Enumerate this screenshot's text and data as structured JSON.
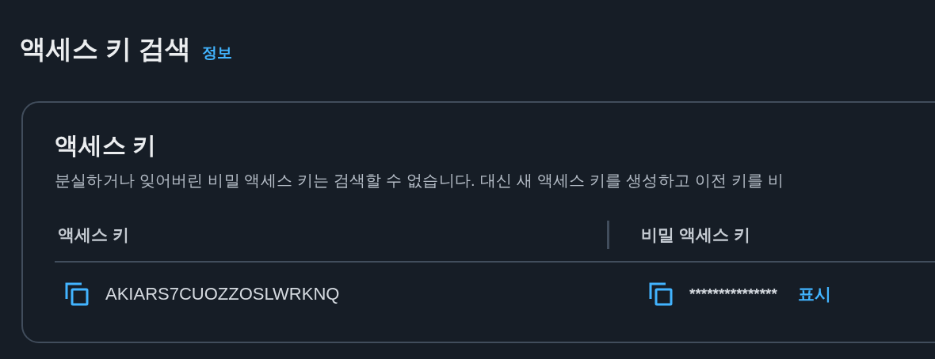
{
  "page": {
    "title": "액세스 키 검색",
    "info_link": "정보"
  },
  "card": {
    "title": "액세스 키",
    "description": "분실하거나 잊어버린 비밀 액세스 키는 검색할 수 없습니다. 대신 새 액세스 키를 생성하고 이전 키를 비",
    "columns": [
      "액세스 키",
      "비밀 액세스 키"
    ],
    "row": {
      "access_key": "AKIARS7CUOZZOSLWRKNQ",
      "secret_key": "***************",
      "show_link": "표시"
    }
  }
}
